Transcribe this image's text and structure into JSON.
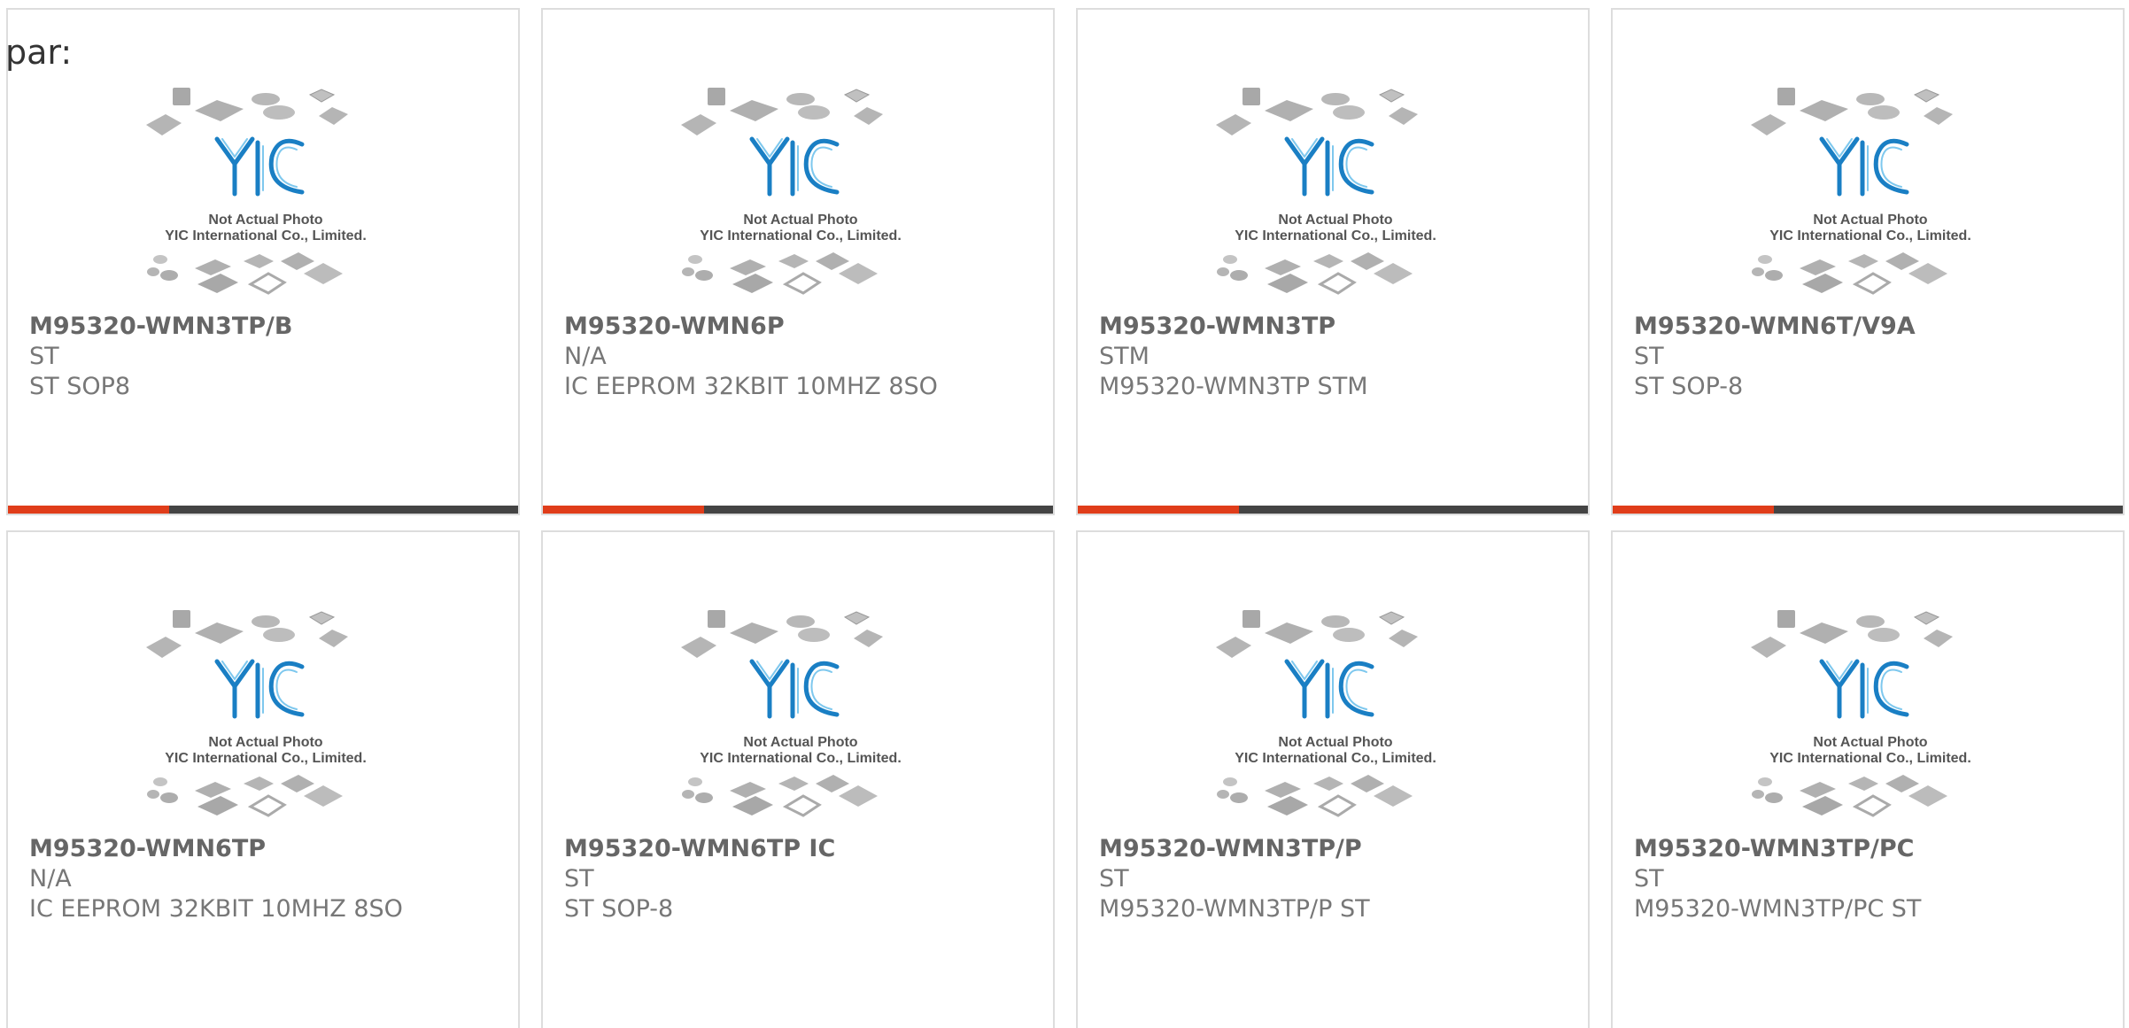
{
  "par_label": "par:",
  "colors": {
    "accent": "#e03d1a",
    "bar": "#444444",
    "logo": "#1a7fc4",
    "text": "#777777"
  },
  "placeholder_photo": {
    "logo_text": "YIC",
    "line1": "Not Actual Photo",
    "line2": "YIC International Co., Limited."
  },
  "products": [
    {
      "part_number": "M95320-WMN3TP/B",
      "manufacturer": "ST",
      "description": "ST SOP8",
      "has_bar": true
    },
    {
      "part_number": "M95320-WMN6P",
      "manufacturer": "N/A",
      "description": "IC EEPROM 32KBIT 10MHZ 8SO",
      "has_bar": true
    },
    {
      "part_number": "M95320-WMN3TP",
      "manufacturer": "STM",
      "description": "M95320-WMN3TP STM",
      "has_bar": true
    },
    {
      "part_number": "M95320-WMN6T/V9A",
      "manufacturer": "ST",
      "description": "ST SOP-8",
      "has_bar": true
    },
    {
      "part_number": "M95320-WMN6TP",
      "manufacturer": "N/A",
      "description": "IC EEPROM 32KBIT 10MHZ 8SO",
      "has_bar": false
    },
    {
      "part_number": "M95320-WMN6TP IC",
      "manufacturer": "ST",
      "description": "ST SOP-8",
      "has_bar": false
    },
    {
      "part_number": "M95320-WMN3TP/P",
      "manufacturer": "ST",
      "description": "M95320-WMN3TP/P ST",
      "has_bar": false
    },
    {
      "part_number": "M95320-WMN3TP/PC",
      "manufacturer": "ST",
      "description": "M95320-WMN3TP/PC ST",
      "has_bar": false
    }
  ]
}
